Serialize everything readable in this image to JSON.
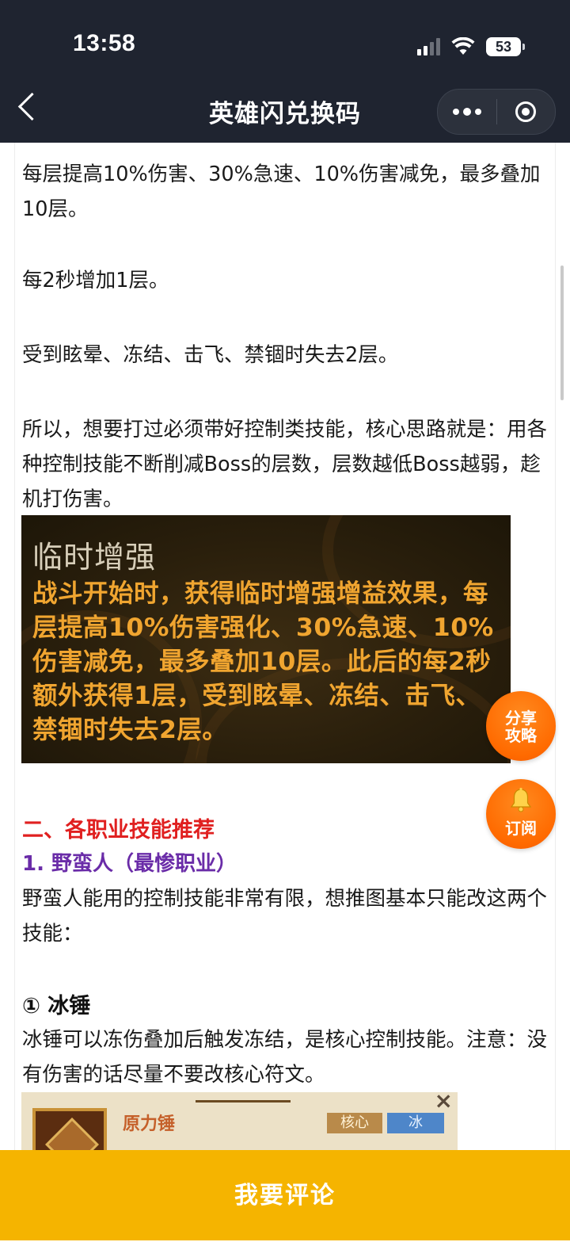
{
  "status_bar": {
    "time": "13:58",
    "battery": "53"
  },
  "nav": {
    "title": "英雄闪兑换码"
  },
  "article": {
    "p1": "每层提高10%伤害、30%急速、10%伤害减免，最多叠加10层。",
    "p2": "每2秒增加1层。",
    "p3": "受到眩晕、冻结、击飞、禁锢时失去2层。",
    "p4": "所以，想要打过必须带好控制类技能，核心思路就是：用各种控制技能不断削减Boss的层数，层数越低Boss越弱，趁机打伤害。",
    "image_card": {
      "title": "临时增强",
      "body": "战斗开始时，获得临时增强增益效果，每层提高10%伤害强化、30%急速、10%伤害减免，最多叠加10层。此后的每2秒额外获得1层，受到眩晕、冻结、击飞、禁锢时失去2层。"
    },
    "section_heading": "二、各职业技能推荐",
    "sub_heading": "1. 野蛮人（最惨职业）",
    "p5": "野蛮人能用的控制技能非常有限，想推图基本只能改这两个技能：",
    "skill_heading": "① 冰锤",
    "p6": "冰锤可以冻伤叠加后触发冻结，是核心控制技能。注意：没有伤害的话尽量不要改核心符文。",
    "skill_card": {
      "name": "原力锤",
      "tag_core": "核心",
      "tag_ice": "冰"
    }
  },
  "floating": {
    "share_line1": "分享",
    "share_line2": "攻略",
    "subscribe": "订阅"
  },
  "bottom": {
    "comment": "我要评论"
  },
  "colors": {
    "accent": "#f5b400",
    "fab": "#ff6a00",
    "heading_red": "#e02020",
    "heading_purple": "#6a2ca8",
    "nav_bg": "#1f2430"
  }
}
